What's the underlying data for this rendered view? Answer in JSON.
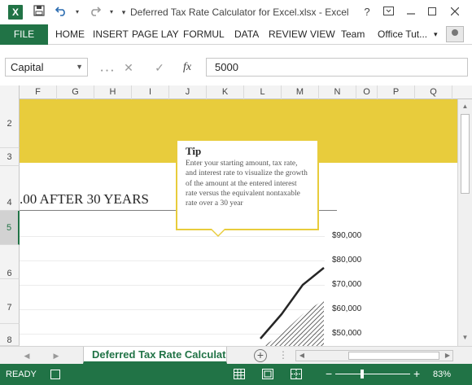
{
  "app": {
    "logo_letter": "X",
    "window_title": "Deferred Tax Rate Calculator for Excel.xlsx - Excel",
    "accent_color": "#217346",
    "banner_color": "#e8cc3c"
  },
  "quick_access": {
    "save_icon": "save-icon",
    "undo_icon": "undo-icon",
    "redo_icon": "redo-icon",
    "customize_icon": "customize-icon"
  },
  "window_controls": {
    "help": "?",
    "restore_ribbon": "ribbon-display-icon",
    "minimize": "minimize-icon",
    "maximize": "maximize-icon",
    "close": "close-icon"
  },
  "ribbon": {
    "file_tab": "FILE",
    "tabs": [
      "HOME",
      "INSERT",
      "PAGE LAY",
      "FORMUL",
      "DATA",
      "REVIEW",
      "VIEW",
      "Team",
      "Office Tut..."
    ],
    "user_menu_arrow": "▾"
  },
  "formula_bar": {
    "name_box": "Capital",
    "cancel_glyph": "✕",
    "enter_glyph": "✓",
    "fx_label": "fx",
    "value": "5000"
  },
  "columns": [
    "F",
    "G",
    "H",
    "I",
    "J",
    "K",
    "L",
    "M",
    "N",
    "O",
    "P",
    "Q"
  ],
  "rows": [
    "2",
    "3",
    "4",
    "5",
    "6",
    "7",
    "8"
  ],
  "sheet": {
    "heading": ".00 AFTER 30 YEARS",
    "tip": {
      "title": "Tip",
      "body": "Enter your starting amount, tax rate, and interest rate to visualize the growth of the amount at the entered interest rate versus the equivalent nontaxable rate over a 30 year"
    }
  },
  "chart_data": {
    "type": "area",
    "title": "",
    "xlabel": "",
    "ylabel": "",
    "y_tick_labels": [
      "$90,000",
      "$80,000",
      "$70,000",
      "$60,000",
      "$50,000"
    ],
    "yticks": [
      90000,
      80000,
      70000,
      60000,
      50000
    ],
    "visible_ylim": [
      45000,
      93000
    ],
    "series": [
      {
        "name": "",
        "style": "line",
        "color": "#262626",
        "values": [
          48000,
          58000,
          70000,
          77000
        ]
      },
      {
        "name": "",
        "style": "hatched-area",
        "color": "#262626",
        "values": [
          44000,
          50000,
          58000,
          64000
        ]
      }
    ]
  },
  "sheet_tabs": {
    "active": "Deferred Tax Rate Calculator",
    "add_sheet_glyph": "+",
    "nav_prev": "◀",
    "nav_next": "▶"
  },
  "status_bar": {
    "status": "READY",
    "zoom_minus": "−",
    "zoom_plus": "+",
    "zoom_level": "83%",
    "zoom_fraction": 0.83
  }
}
